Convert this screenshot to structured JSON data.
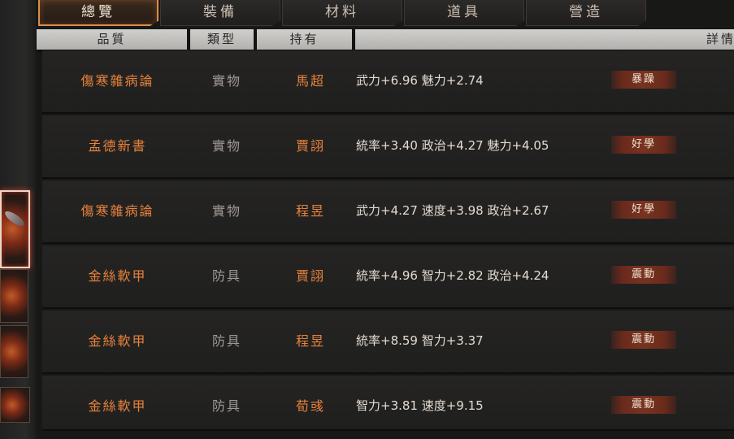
{
  "tabs": [
    {
      "label": "總覽",
      "active": true
    },
    {
      "label": "裝備",
      "active": false
    },
    {
      "label": "材料",
      "active": false
    },
    {
      "label": "道具",
      "active": false
    },
    {
      "label": "營造",
      "active": false
    }
  ],
  "columns": {
    "quality": "品質",
    "type": "類型",
    "owner": "持有",
    "details": "詳情"
  },
  "rows": [
    {
      "name": "傷寒雜病論",
      "type": "實物",
      "owner": "馬超",
      "attrs": "武力+6.96  魅力+2.74",
      "trait": "暴躁"
    },
    {
      "name": "孟德新書",
      "type": "實物",
      "owner": "賈詡",
      "attrs": "統率+3.40  政治+4.27  魅力+4.05",
      "trait": "好學"
    },
    {
      "name": "傷寒雜病論",
      "type": "實物",
      "owner": "程昱",
      "attrs": "武力+4.27  速度+3.98  政治+2.67",
      "trait": "好學"
    },
    {
      "name": "金絲軟甲",
      "type": "防具",
      "owner": "賈詡",
      "attrs": "統率+4.96  智力+2.82  政治+4.24",
      "trait": "震動"
    },
    {
      "name": "金絲軟甲",
      "type": "防具",
      "owner": "程昱",
      "attrs": "統率+8.59  智力+3.37",
      "trait": "震動"
    },
    {
      "name": "金絲軟甲",
      "type": "防具",
      "owner": "荀彧",
      "attrs": "智力+3.81  速度+9.15",
      "trait": "震動"
    }
  ],
  "colors": {
    "accent": "#e8823c",
    "tab_active_border": "#d88d4a",
    "badge_bg": "#78331f"
  },
  "thumbnails": [
    {
      "icon": "blade-weapon-icon",
      "selected": true
    },
    {
      "icon": "red-item-icon",
      "selected": false
    },
    {
      "icon": "red-item-icon",
      "selected": false
    },
    {
      "icon": "red-item-icon",
      "selected": false
    }
  ]
}
